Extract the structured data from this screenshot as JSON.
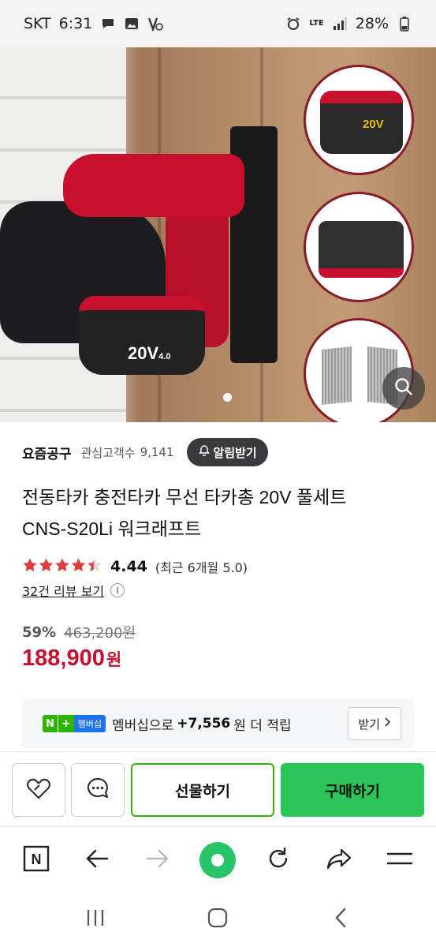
{
  "status_bar": {
    "carrier": "SKT",
    "time": "6:31",
    "network": "LTE",
    "battery": "28%"
  },
  "hero": {
    "battery_text": "20V",
    "battery_sub": "4.0",
    "circle_battery_text": "20V",
    "page_dot_count": 1
  },
  "store": {
    "name": "요즘공구",
    "follower_label": "관심고객수",
    "follower_count": "9,141",
    "alarm_button": "알림받기"
  },
  "product": {
    "title_line1": "전동타카 충전타카 무선 타카총 20V 풀세트",
    "title_line2": "CNS-S20Li 워크래프트",
    "rating": "4.44",
    "rating_value": 4.44,
    "rating_note": "(최근 6개월 5.0)",
    "review_link": "32건 리뷰 보기",
    "discount": "59%",
    "original_price": "463,200원",
    "price": "188,900",
    "price_unit": "원"
  },
  "membership": {
    "badge_n": "N",
    "badge_plus": "+",
    "badge_text": "멤버십",
    "text": "멤버십으로",
    "points": "+7,556",
    "suffix": "원 더 적립",
    "receive_button": "받기"
  },
  "actions": {
    "gift": "선물하기",
    "buy": "구매하기"
  },
  "browser_bar": {
    "logo": "N"
  },
  "colors": {
    "accent_red": "#c8102e",
    "naver_green": "#2db400",
    "buy_green": "#2cc45a",
    "star_red": "#e23a3a"
  }
}
